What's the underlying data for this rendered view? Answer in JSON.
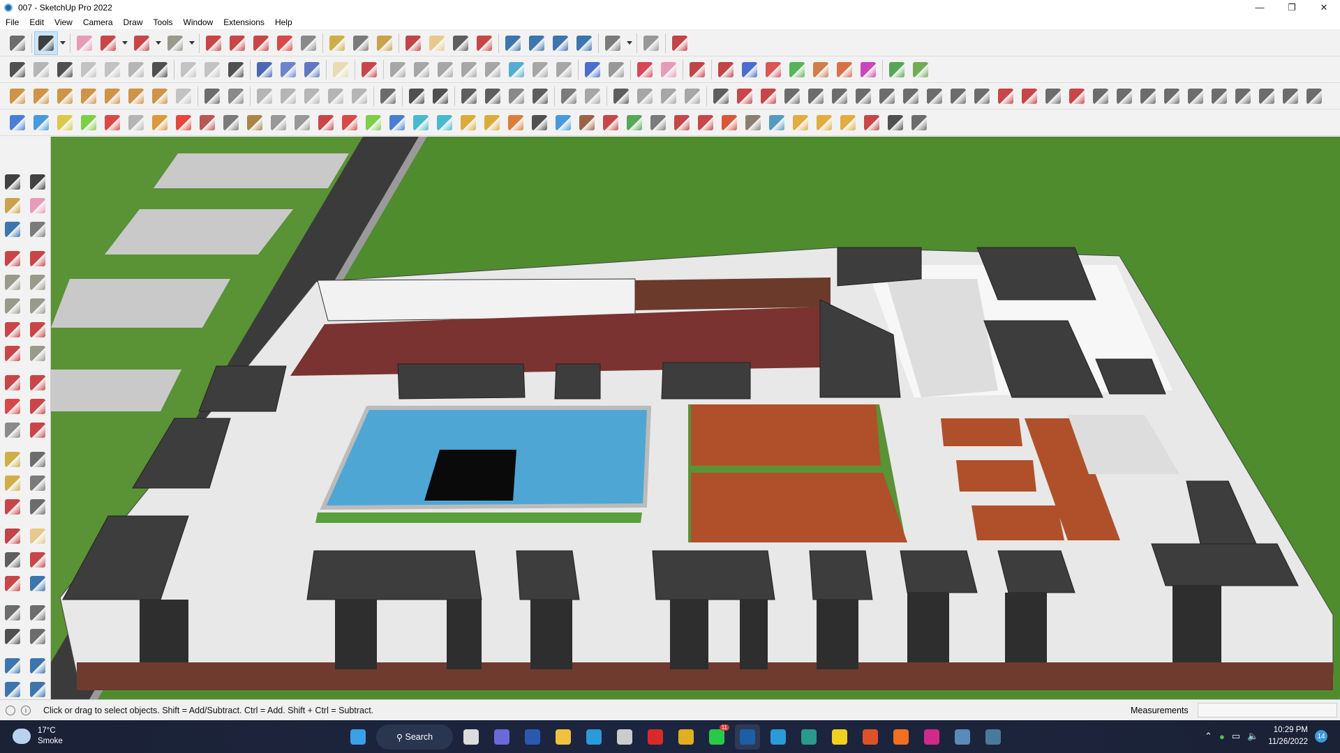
{
  "window": {
    "title": "007 - SketchUp Pro 2022",
    "controls": [
      "—",
      "❐",
      "✕"
    ]
  },
  "menu": [
    "File",
    "Edit",
    "View",
    "Camera",
    "Draw",
    "Tools",
    "Window",
    "Extensions",
    "Help"
  ],
  "toolbars": {
    "row1": [
      {
        "name": "zoom-extents",
        "color": "#555"
      },
      "|",
      {
        "name": "select",
        "color": "#222",
        "selected": true
      },
      {
        "name": "dropdown",
        "color": "#333"
      },
      "|",
      {
        "name": "eraser",
        "color": "#e58cae"
      },
      {
        "name": "line",
        "color": "#c0282a"
      },
      {
        "name": "dropdown",
        "color": "#333"
      },
      {
        "name": "arc",
        "color": "#c0282a"
      },
      {
        "name": "dropdown",
        "color": "#333"
      },
      {
        "name": "rectangle",
        "color": "#8a8a7a"
      },
      {
        "name": "dropdown",
        "color": "#333"
      },
      "|",
      {
        "name": "push-pull",
        "color": "#c0282a"
      },
      {
        "name": "follow-me",
        "color": "#c0282a"
      },
      {
        "name": "move",
        "color": "#c0282a"
      },
      {
        "name": "rotate",
        "color": "#d42a2a"
      },
      {
        "name": "scale",
        "color": "#777"
      },
      "|",
      {
        "name": "tape-measure",
        "color": "#c9a22a"
      },
      {
        "name": "text",
        "color": "#666"
      },
      {
        "name": "paint-bucket",
        "color": "#c4942e"
      },
      "|",
      {
        "name": "orbit",
        "color": "#b8262a"
      },
      {
        "name": "pan",
        "color": "#e6c27a"
      },
      {
        "name": "zoom",
        "color": "#444"
      },
      {
        "name": "zoom-window",
        "color": "#c0282a"
      },
      "|",
      {
        "name": "warehouse",
        "color": "#1d5fa3"
      },
      {
        "name": "extension-warehouse",
        "color": "#1d5fa3"
      },
      {
        "name": "layout",
        "color": "#1d5fa3"
      },
      {
        "name": "extension-manager",
        "color": "#1d5fa3"
      },
      "|",
      {
        "name": "profile",
        "color": "#666"
      },
      {
        "name": "dropdown",
        "color": "#333"
      },
      "|",
      {
        "name": "soften",
        "color": "#888"
      },
      "|",
      {
        "name": "ruby",
        "color": "#b8262a"
      }
    ],
    "row2": [
      {
        "name": "section-plane",
        "color": "#333"
      },
      {
        "name": "make-component",
        "color": "#aaa"
      },
      {
        "name": "group",
        "color": "#333"
      },
      {
        "name": "sandbox",
        "color": "#bbb"
      },
      {
        "name": "outliner",
        "color": "#bbb"
      },
      {
        "name": "components",
        "color": "#aaa"
      },
      {
        "name": "solid",
        "color": "#333"
      },
      "|",
      {
        "name": "grid",
        "color": "#bbb"
      },
      {
        "name": "copy",
        "color": "#bbb"
      },
      {
        "name": "hide",
        "color": "#333"
      },
      "|",
      {
        "name": "axis-x",
        "color": "#2d4fa8"
      },
      {
        "name": "axis-y",
        "color": "#5370c4"
      },
      {
        "name": "axis-z",
        "color": "#4763b8"
      },
      "|",
      {
        "name": "material",
        "color": "#e9d8a6"
      },
      "|",
      {
        "name": "draw-edit",
        "color": "#c0282a"
      },
      "|",
      {
        "name": "shape-rect",
        "color": "#999"
      },
      {
        "name": "shape-circle",
        "color": "#999"
      },
      {
        "name": "shape-polygon",
        "color": "#999"
      },
      {
        "name": "shape-ellipse",
        "color": "#999"
      },
      {
        "name": "shape-parallelogram",
        "color": "#999"
      },
      {
        "name": "shape-arc",
        "color": "#3aa0c8"
      },
      {
        "name": "shape-ring",
        "color": "#999"
      },
      {
        "name": "shape-spiral",
        "color": "#999"
      },
      "|",
      {
        "name": "tool-offset",
        "color": "#2c56c4"
      },
      {
        "name": "tool-rotate",
        "color": "#888"
      },
      "|",
      {
        "name": "tool-extend",
        "color": "#d4283a"
      },
      {
        "name": "tool-erase",
        "color": "#e58cae"
      },
      "|",
      {
        "name": "pushpull-red",
        "color": "#b8262a"
      },
      "|",
      {
        "name": "pp-1",
        "color": "#b8262a"
      },
      {
        "name": "pp-2",
        "color": "#2c56c4"
      },
      {
        "name": "pp-3",
        "color": "#d43a3a"
      },
      {
        "name": "pp-4",
        "color": "#3aa83a"
      },
      {
        "name": "pp-5",
        "color": "#c86a2a"
      },
      {
        "name": "pp-6",
        "color": "#d45a2a"
      },
      {
        "name": "pp-7",
        "color": "#c02ab0"
      },
      "|",
      {
        "name": "terrain",
        "color": "#3a9a3a"
      },
      {
        "name": "trees",
        "color": "#5aa03a"
      }
    ],
    "row3": [
      {
        "name": "render-house",
        "color": "#c9842a"
      },
      {
        "name": "spot-light",
        "color": "#c9842a"
      },
      {
        "name": "ring-light",
        "color": "#c9842a"
      },
      {
        "name": "cone-light",
        "color": "#c9842a"
      },
      {
        "name": "lamp",
        "color": "#c9842a"
      },
      {
        "name": "sun",
        "color": "#c9842a"
      },
      {
        "name": "dome",
        "color": "#c9842a"
      },
      {
        "name": "proxy",
        "color": "#bbb"
      },
      "|",
      {
        "name": "sphere-mask",
        "color": "#555"
      },
      {
        "name": "dashed-sphere",
        "color": "#777"
      },
      "|",
      {
        "name": "uv-1",
        "color": "#aaa"
      },
      {
        "name": "uv-2",
        "color": "#aaa"
      },
      {
        "name": "uv-3",
        "color": "#aaa"
      },
      {
        "name": "uv-4",
        "color": "#aaa"
      },
      {
        "name": "uv-5",
        "color": "#aaa"
      },
      "|",
      {
        "name": "interactive",
        "color": "#555"
      },
      "|",
      {
        "name": "vray",
        "color": "#333"
      },
      {
        "name": "vray-2",
        "color": "#333"
      },
      "|",
      {
        "name": "teapot",
        "color": "#444"
      },
      {
        "name": "teapot-2",
        "color": "#444"
      },
      {
        "name": "teapot-3",
        "color": "#777"
      },
      {
        "name": "refresh",
        "color": "#444"
      },
      "|",
      {
        "name": "frame-1",
        "color": "#666"
      },
      {
        "name": "frame-2",
        "color": "#999"
      },
      "|",
      {
        "name": "window-1",
        "color": "#444"
      },
      {
        "name": "window-2",
        "color": "#999"
      },
      {
        "name": "window-3",
        "color": "#999"
      },
      {
        "name": "window-4",
        "color": "#999"
      },
      "|",
      {
        "name": "curve-1",
        "color": "#444"
      },
      {
        "name": "curve-2",
        "color": "#c0282a"
      },
      {
        "name": "curve-3",
        "color": "#c0282a"
      },
      {
        "name": "curve-4",
        "color": "#555"
      },
      {
        "name": "curve-5",
        "color": "#555"
      },
      {
        "name": "curve-6",
        "color": "#555"
      },
      {
        "name": "curve-7",
        "color": "#555"
      },
      {
        "name": "curve-8",
        "color": "#555"
      },
      {
        "name": "curve-9",
        "color": "#555"
      },
      {
        "name": "curve-10",
        "color": "#555"
      },
      {
        "name": "curve-11",
        "color": "#555"
      },
      {
        "name": "curve-12",
        "color": "#555"
      },
      {
        "name": "curve-13",
        "color": "#c0282a"
      },
      {
        "name": "curve-14",
        "color": "#c0282a"
      },
      {
        "name": "curve-15",
        "color": "#555"
      },
      {
        "name": "curve-16",
        "color": "#c0282a"
      },
      {
        "name": "curve-17",
        "color": "#555"
      },
      {
        "name": "curve-18",
        "color": "#555"
      },
      {
        "name": "curve-19",
        "color": "#555"
      },
      {
        "name": "curve-20",
        "color": "#555"
      },
      {
        "name": "curve-21",
        "color": "#555"
      },
      {
        "name": "curve-22",
        "color": "#555"
      },
      {
        "name": "curve-23",
        "color": "#555"
      },
      {
        "name": "curve-24",
        "color": "#555"
      },
      {
        "name": "curve-25",
        "color": "#555"
      },
      {
        "name": "curve-26",
        "color": "#555"
      }
    ],
    "row4": [
      {
        "name": "plane-blue-red",
        "color": "#2a6ad0"
      },
      {
        "name": "plane-blue",
        "color": "#2a8ad8"
      },
      {
        "name": "plane-yellow",
        "color": "#d8c02a"
      },
      {
        "name": "plane-green",
        "color": "#6ac82a"
      },
      {
        "name": "plane-red",
        "color": "#d82a2a"
      },
      {
        "name": "plane-grid",
        "color": "#aaa"
      },
      {
        "name": "spiral",
        "color": "#d88a1a"
      },
      {
        "name": "square-red",
        "color": "#e02a1a"
      },
      {
        "name": "panel",
        "color": "#b03a3a"
      },
      {
        "name": "flag",
        "color": "#666"
      },
      {
        "name": "fold",
        "color": "#a0702a"
      },
      {
        "name": "pipe",
        "color": "#888"
      },
      {
        "name": "bend",
        "color": "#888"
      },
      {
        "name": "dots",
        "color": "#c0282a"
      },
      {
        "name": "plus-red",
        "color": "#d82a2a"
      },
      {
        "name": "plus-green",
        "color": "#6ac82a"
      },
      {
        "name": "cross-blue",
        "color": "#2a6ad0"
      },
      {
        "name": "drop",
        "color": "#2ab0c8"
      },
      {
        "name": "drop-hash",
        "color": "#2ab0c8"
      },
      {
        "name": "triangle",
        "color": "#d8a01a"
      },
      {
        "name": "hook",
        "color": "#d8a01a"
      },
      {
        "name": "hook-red",
        "color": "#d86a1a"
      },
      {
        "name": "loop",
        "color": "#333"
      },
      {
        "name": "star-arrows",
        "color": "#2a8ad8"
      },
      {
        "name": "box",
        "color": "#8a4a2a"
      },
      {
        "name": "undo-red",
        "color": "#c0282a"
      },
      {
        "name": "chain",
        "color": "#3a9a3a"
      },
      {
        "name": "cube-1",
        "color": "#666"
      },
      {
        "name": "cube-2",
        "color": "#c0282a"
      },
      {
        "name": "cube-3",
        "color": "#c0282a"
      },
      {
        "name": "gem",
        "color": "#d83a1a"
      },
      {
        "name": "boxes",
        "color": "#7a6a5a"
      },
      {
        "name": "frame-blue",
        "color": "#3a8ab8"
      },
      {
        "name": "grid-orange-1",
        "color": "#e0a020"
      },
      {
        "name": "grid-orange-2",
        "color": "#e0a020"
      },
      {
        "name": "grid-orange-3",
        "color": "#e0a020"
      },
      {
        "name": "scatter",
        "color": "#c0282a"
      },
      {
        "name": "curve-dots",
        "color": "#333"
      },
      {
        "name": "qr",
        "color": "#555"
      }
    ],
    "left": [
      {
        "name": "select",
        "color": "#222"
      },
      {
        "name": "orbit-select",
        "color": "#222"
      },
      {
        "name": "paint-bucket",
        "color": "#c4942e"
      },
      {
        "name": "eraser",
        "color": "#e58cae"
      },
      {
        "name": "make-component",
        "color": "#1d5fa3"
      },
      {
        "name": "tag",
        "color": "#666"
      },
      "gap",
      {
        "name": "line",
        "color": "#c0282a"
      },
      {
        "name": "freehand",
        "color": "#c0282a"
      },
      {
        "name": "rectangle",
        "color": "#8a8a7a"
      },
      {
        "name": "rotated-rectangle",
        "color": "#8a8a7a"
      },
      {
        "name": "circle",
        "color": "#8a8a7a"
      },
      {
        "name": "polygon",
        "color": "#8a8a7a"
      },
      {
        "name": "arc",
        "color": "#c0282a"
      },
      {
        "name": "arc-2pt",
        "color": "#c0282a"
      },
      {
        "name": "arc-3pt",
        "color": "#c0282a"
      },
      {
        "name": "pie",
        "color": "#8a8a7a"
      },
      "gap",
      {
        "name": "move",
        "color": "#c0282a"
      },
      {
        "name": "push-pull",
        "color": "#c0282a"
      },
      {
        "name": "rotate",
        "color": "#d42a2a"
      },
      {
        "name": "follow-me",
        "color": "#c0282a"
      },
      {
        "name": "scale",
        "color": "#777"
      },
      {
        "name": "offset",
        "color": "#c0282a"
      },
      "gap",
      {
        "name": "tape-measure",
        "color": "#c9a22a"
      },
      {
        "name": "dimension",
        "color": "#555"
      },
      {
        "name": "protractor",
        "color": "#c9a22a"
      },
      {
        "name": "text",
        "color": "#666"
      },
      {
        "name": "axes",
        "color": "#c0282a"
      },
      {
        "name": "3d-text",
        "color": "#555"
      },
      "gap",
      {
        "name": "orbit",
        "color": "#b8262a"
      },
      {
        "name": "pan",
        "color": "#e6c27a"
      },
      {
        "name": "zoom",
        "color": "#444"
      },
      {
        "name": "zoom-window",
        "color": "#c0282a"
      },
      {
        "name": "zoom-extents",
        "color": "#c0282a"
      },
      {
        "name": "previous",
        "color": "#1d5fa3"
      },
      "gap",
      {
        "name": "position-camera",
        "color": "#555"
      },
      {
        "name": "look-around",
        "color": "#555"
      },
      {
        "name": "walk",
        "color": "#333"
      },
      {
        "name": "section-plane",
        "color": "#555"
      },
      "gap",
      {
        "name": "warehouse",
        "color": "#1d5fa3"
      },
      {
        "name": "extension-warehouse",
        "color": "#1d5fa3"
      },
      {
        "name": "layout",
        "color": "#1d5fa3"
      },
      {
        "name": "extension-manager",
        "color": "#1d5fa3"
      }
    ]
  },
  "status": {
    "hint": "Click or drag to select objects. Shift = Add/Subtract. Ctrl = Add. Shift + Ctrl = Subtract.",
    "measurements_label": "Measurements",
    "measurements_value": ""
  },
  "taskbar": {
    "weather_temp": "17°C",
    "weather_desc": "Smoke",
    "search_label": "Search",
    "apps": [
      {
        "name": "start",
        "color": "#3aa0e8"
      },
      {
        "name": "search",
        "color": ""
      },
      {
        "name": "task-view",
        "color": "#ddd"
      },
      {
        "name": "teams-chat",
        "color": "#6a6ad8"
      },
      {
        "name": "calculator",
        "color": "#2a5ab0"
      },
      {
        "name": "file-explorer",
        "color": "#f0c040"
      },
      {
        "name": "edge",
        "color": "#2a9ad8"
      },
      {
        "name": "store",
        "color": "#ccc"
      },
      {
        "name": "opera",
        "color": "#d82a2a"
      },
      {
        "name": "chrome",
        "color": "#e0b020"
      },
      {
        "name": "whatsapp",
        "color": "#2ac84a"
      },
      {
        "name": "sketchup",
        "color": "#1d5fa3"
      },
      {
        "name": "telegram",
        "color": "#2a9ad8"
      },
      {
        "name": "app-teal",
        "color": "#2a9a8a"
      },
      {
        "name": "sticky-notes",
        "color": "#f0d020"
      },
      {
        "name": "brave",
        "color": "#e0502a"
      },
      {
        "name": "soundcloud",
        "color": "#f07020"
      },
      {
        "name": "instagram",
        "color": "#d02a8a"
      },
      {
        "name": "photo-viewer",
        "color": "#5a8ab8"
      },
      {
        "name": "snipping",
        "color": "#4a7a9a"
      }
    ],
    "whatsapp_badge": "11",
    "time": "10:29 PM",
    "date": "11/26/2022",
    "notification_count": "14"
  }
}
